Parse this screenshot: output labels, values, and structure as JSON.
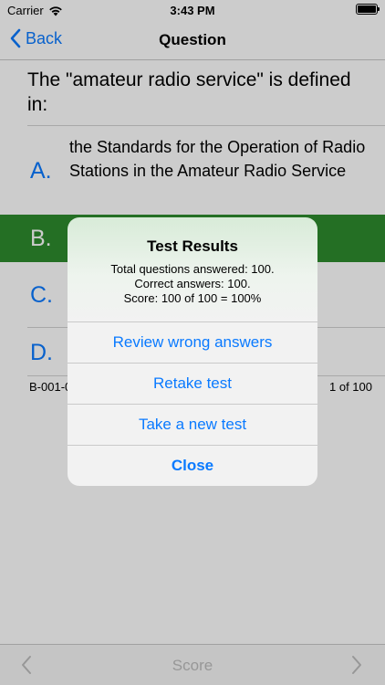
{
  "status": {
    "carrier": "Carrier",
    "time": "3:43 PM"
  },
  "nav": {
    "back_label": "Back",
    "title": "Question"
  },
  "question": {
    "text": "The \"amateur radio service\" is defined in:",
    "options": [
      {
        "letter": "A.",
        "text": "the Standards for the Operation of Radio Stations in the Amateur Radio Service"
      },
      {
        "letter": "B.",
        "text": ""
      },
      {
        "letter": "C.",
        "text": ""
      },
      {
        "letter": "D.",
        "text": ""
      }
    ],
    "selected_color": "#2e8b2e"
  },
  "footer": {
    "question_id": "B-001-0",
    "position": "1 of 100"
  },
  "toolbar": {
    "score_label": "Score"
  },
  "alert": {
    "title": "Test Results",
    "lines": [
      "Total questions answered: 100.",
      "Correct answers: 100.",
      "Score: 100 of 100 = 100%"
    ],
    "buttons": [
      "Review wrong answers",
      "Retake test",
      "Take a new test",
      "Close"
    ]
  },
  "colors": {
    "accent": "#0a7aff",
    "correct": "#2e8b2e"
  }
}
